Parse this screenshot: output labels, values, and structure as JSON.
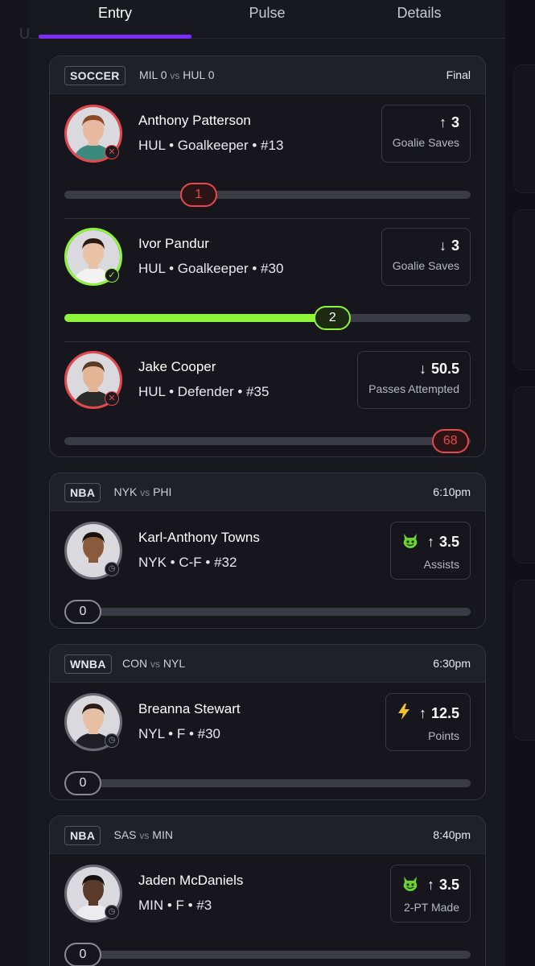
{
  "tabs": [
    {
      "label": "Entry",
      "active": true
    },
    {
      "label": "Pulse",
      "active": false
    },
    {
      "label": "Details",
      "active": false
    }
  ],
  "colors": {
    "accent": "#7b2cf5",
    "hit": "#8ef53a",
    "miss": "#e5484d",
    "pending": "#8a8a94"
  },
  "cards": [
    {
      "league": "SOCCER",
      "home": "MIL",
      "home_score": "0",
      "vs": "vs",
      "away": "HUL",
      "away_score": "0",
      "status": "Final",
      "players": [
        {
          "name": "Anthony Patterson",
          "info": "HUL • Goalkeeper • #13",
          "result": "miss",
          "icon": "x-icon",
          "direction": "up",
          "line": "3",
          "stat": "Goalie Saves",
          "emoji": "",
          "current": "1",
          "progress": 0.33
        },
        {
          "name": "Ivor Pandur",
          "info": "HUL • Goalkeeper • #30",
          "result": "hit",
          "icon": "check-icon",
          "direction": "down",
          "line": "3",
          "stat": "Goalie Saves",
          "emoji": "",
          "current": "2",
          "progress": 0.66
        },
        {
          "name": "Jake Cooper",
          "info": "HUL • Defender • #35",
          "result": "miss",
          "icon": "x-icon",
          "direction": "down",
          "line": "50.5",
          "stat": "Passes Attempted",
          "emoji": "",
          "current": "68",
          "progress": 0.95
        }
      ]
    },
    {
      "league": "NBA",
      "home": "NYK",
      "vs": "vs",
      "away": "PHI",
      "status": "6:10pm",
      "players": [
        {
          "name": "Karl-Anthony Towns",
          "info": "NYK • C-F • #32",
          "result": "pending",
          "icon": "clock-icon",
          "direction": "up",
          "line": "3.5",
          "stat": "Assists",
          "emoji": "devil-emoji",
          "current": "0",
          "progress": 0
        }
      ]
    },
    {
      "league": "WNBA",
      "home": "CON",
      "vs": "vs",
      "away": "NYL",
      "status": "6:30pm",
      "players": [
        {
          "name": "Breanna Stewart",
          "info": "NYL • F • #30",
          "result": "pending",
          "icon": "clock-icon",
          "direction": "up",
          "line": "12.5",
          "stat": "Points",
          "emoji": "lightning-emoji",
          "current": "0",
          "progress": 0
        }
      ]
    },
    {
      "league": "NBA",
      "home": "SAS",
      "vs": "vs",
      "away": "MIN",
      "status": "8:40pm",
      "players": [
        {
          "name": "Jaden McDaniels",
          "info": "MIN • F • #3",
          "result": "pending",
          "icon": "clock-icon",
          "direction": "up",
          "line": "3.5",
          "stat": "2-PT Made",
          "emoji": "devil-emoji",
          "current": "0",
          "progress": 0
        }
      ]
    }
  ]
}
